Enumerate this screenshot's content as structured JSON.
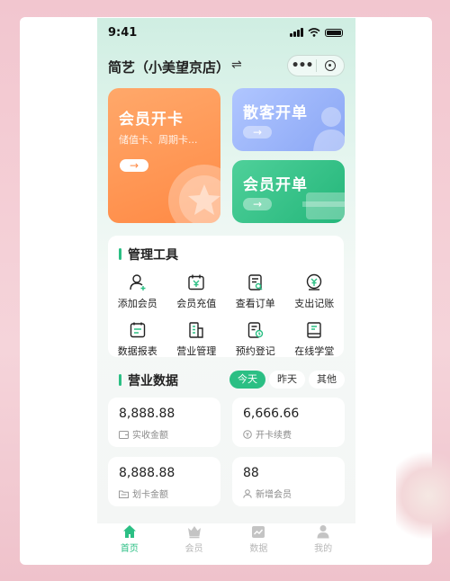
{
  "status_bar": {
    "time": "9:41"
  },
  "header": {
    "store_name": "简艺（小美望京店）",
    "swap_icon": "⇌",
    "more_dots": "•••"
  },
  "quick_actions": [
    {
      "title": "会员开卡",
      "subtitle": "储值卡、周期卡...",
      "arrow": "→",
      "color": "#ff9552"
    },
    {
      "title": "散客开单",
      "arrow": "→",
      "color": "#9cb5fb"
    },
    {
      "title": "会员开单",
      "arrow": "→",
      "color": "#34c287"
    }
  ],
  "tools": {
    "title": "管理工具",
    "items": [
      {
        "label": "添加会员",
        "icon": "add-member-icon"
      },
      {
        "label": "会员充值",
        "icon": "member-recharge-icon"
      },
      {
        "label": "查看订单",
        "icon": "view-orders-icon"
      },
      {
        "label": "支出记账",
        "icon": "expense-ledger-icon"
      },
      {
        "label": "数据报表",
        "icon": "data-report-icon"
      },
      {
        "label": "营业管理",
        "icon": "business-management-icon"
      },
      {
        "label": "预约登记",
        "icon": "appointment-icon"
      },
      {
        "label": "在线学堂",
        "icon": "online-school-icon"
      }
    ]
  },
  "business": {
    "title": "营业数据",
    "filters": [
      "今天",
      "昨天",
      "其他"
    ],
    "active_filter": "今天",
    "stats": [
      {
        "value": "8,888.88",
        "label": "实收金额",
        "icon": "wallet-icon"
      },
      {
        "value": "6,666.66",
        "label": "开卡续费",
        "icon": "coin-icon"
      },
      {
        "value": "8,888.88",
        "label": "划卡金额",
        "icon": "folder-icon"
      },
      {
        "value": "88",
        "label": "新增会员",
        "icon": "user-icon"
      }
    ]
  },
  "tabbar": {
    "items": [
      {
        "label": "首页",
        "icon": "home-icon"
      },
      {
        "label": "会员",
        "icon": "crown-icon"
      },
      {
        "label": "数据",
        "icon": "chart-icon"
      },
      {
        "label": "我的",
        "icon": "profile-icon"
      }
    ],
    "active": "首页"
  },
  "colors": {
    "accent": "#2bbf84",
    "orange": "#ff9552",
    "blue": "#9cb5fb",
    "green": "#34c287"
  }
}
